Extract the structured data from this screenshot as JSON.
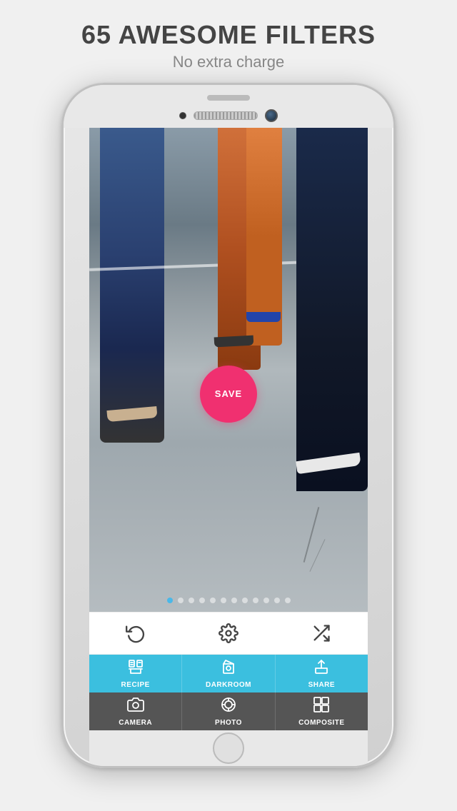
{
  "header": {
    "title": "65 AWESOME FILTERS",
    "subtitle": "No extra charge"
  },
  "photo": {
    "save_button_label": "SAVE"
  },
  "filter_dots": {
    "total": 12,
    "active_index": 0
  },
  "toolbar": {
    "undo_icon": "undo-icon",
    "settings_icon": "settings-icon",
    "shuffle_icon": "shuffle-icon"
  },
  "tabs": {
    "top_row": [
      {
        "id": "recipe",
        "label": "RECIPE",
        "active": true
      },
      {
        "id": "darkroom",
        "label": "DARKROOM",
        "active": true
      },
      {
        "id": "share",
        "label": "SHARE",
        "active": false
      }
    ],
    "bottom_row": [
      {
        "id": "camera",
        "label": "CAMERA",
        "active": false
      },
      {
        "id": "photo",
        "label": "PHOTO",
        "active": false
      },
      {
        "id": "composite",
        "label": "COMPOSITE",
        "active": false
      }
    ]
  }
}
